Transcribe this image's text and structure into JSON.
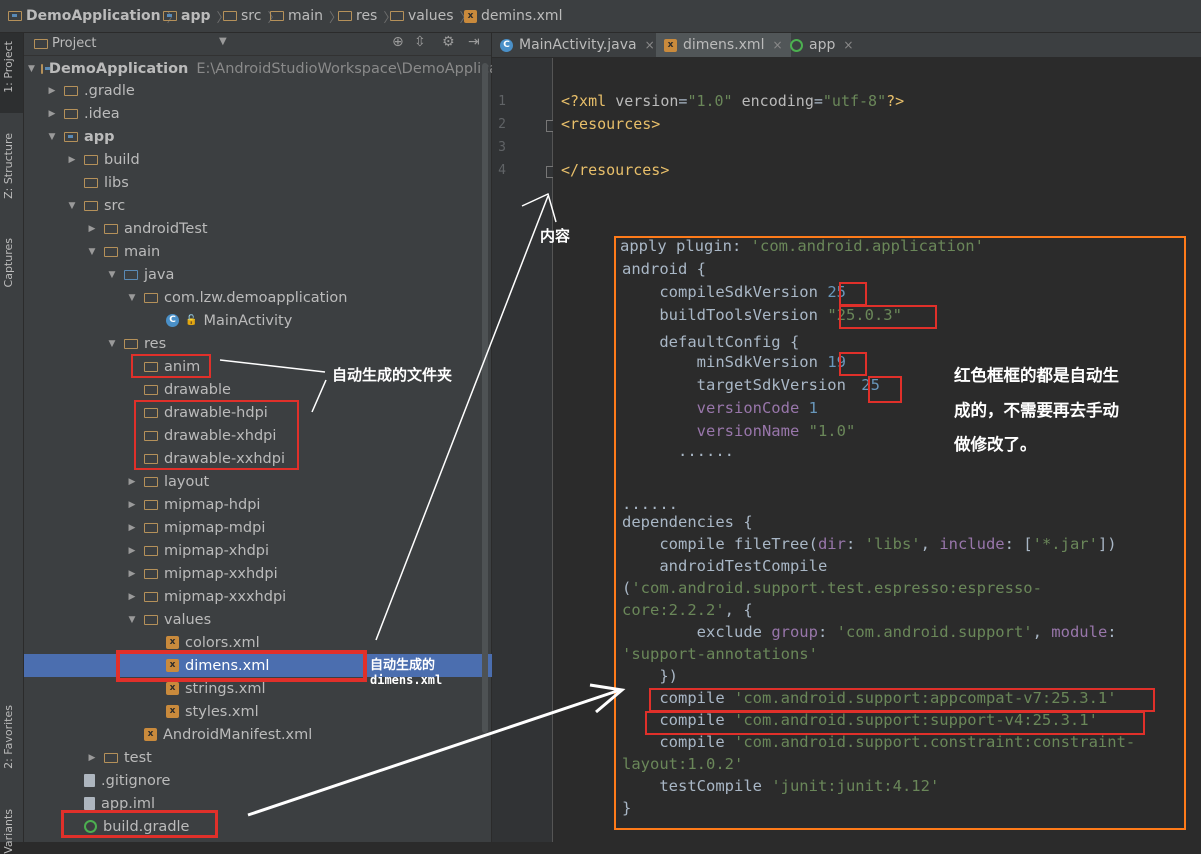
{
  "breadcrumb": [
    {
      "label": "DemoApplication",
      "icon": "folder-icon"
    },
    {
      "label": "app",
      "icon": "module-folder-icon"
    },
    {
      "label": "src",
      "icon": "folder-icon"
    },
    {
      "label": "main",
      "icon": "folder-icon"
    },
    {
      "label": "res",
      "icon": "res-folder-icon"
    },
    {
      "label": "values",
      "icon": "folder-icon"
    },
    {
      "label": "demins.xml",
      "icon": "xml-icon"
    }
  ],
  "side_tabs": {
    "project": "1: Project",
    "structure": "Z: Structure",
    "captures": "Captures",
    "favorites": "2: Favorites",
    "variants": "Variants"
  },
  "project_panel": {
    "header": "Project",
    "root": {
      "label": "DemoApplication",
      "path": "E:\\AndroidStudioWorkspace\\DemoApplicati"
    },
    "items": [
      {
        "label": ".gradle"
      },
      {
        "label": ".idea"
      },
      {
        "label": "app"
      },
      {
        "label": "build"
      },
      {
        "label": "libs"
      },
      {
        "label": "src"
      },
      {
        "label": "androidTest"
      },
      {
        "label": "main"
      },
      {
        "label": "java"
      },
      {
        "label": "com.lzw.demoapplication"
      },
      {
        "label": "MainActivity"
      },
      {
        "label": "res"
      },
      {
        "label": "anim"
      },
      {
        "label": "drawable"
      },
      {
        "label": "drawable-hdpi"
      },
      {
        "label": "drawable-xhdpi"
      },
      {
        "label": "drawable-xxhdpi"
      },
      {
        "label": "layout"
      },
      {
        "label": "mipmap-hdpi"
      },
      {
        "label": "mipmap-mdpi"
      },
      {
        "label": "mipmap-xhdpi"
      },
      {
        "label": "mipmap-xxhdpi"
      },
      {
        "label": "mipmap-xxxhdpi"
      },
      {
        "label": "values"
      },
      {
        "label": "colors.xml"
      },
      {
        "label": "dimens.xml"
      },
      {
        "label": "strings.xml"
      },
      {
        "label": "styles.xml"
      },
      {
        "label": "AndroidManifest.xml"
      },
      {
        "label": "test"
      },
      {
        "label": ".gitignore"
      },
      {
        "label": "app.iml"
      },
      {
        "label": "build.gradle"
      }
    ]
  },
  "editor_tabs": [
    {
      "label": "MainActivity.java"
    },
    {
      "label": "dimens.xml"
    },
    {
      "label": "app"
    }
  ],
  "editor": {
    "line_numbers": [
      "1",
      "2",
      "3",
      "4"
    ],
    "lines": {
      "l1a": "<?xml ",
      "l1b": "version",
      "l1c": "=",
      "l1d": "\"1.0\"",
      "l1e": " encoding",
      "l1f": "=",
      "l1g": "\"utf-8\"",
      "l1h": "?>",
      "l2": "<resources>",
      "l4": "</resources>"
    }
  },
  "overlay_code": {
    "l0a": "apply plugin: ",
    "l0b": "'com.android.application'",
    "l1": "android {",
    "l2a": "    compileSdkVersion ",
    "l2b": "25",
    "l3a": "    buildToolsVersion ",
    "l3b": "\"25.0.3\"",
    "l4": "    defaultConfig {",
    "l5a": "        minSdkVersion ",
    "l5b": "19",
    "l6a": "        targetSdkVersion ",
    "l6b": "25",
    "l7a": "        versionCode ",
    "l7b": "1",
    "l8a": "        versionName ",
    "l8b": "\"1.0\"",
    "l9": "      ......",
    "l10": "......",
    "l11": "dependencies {",
    "l12a": "    compile fileTree(",
    "l12b": "dir",
    ": ": "",
    "l12c": ": ",
    "l12d": "'libs'",
    "l12e": ", ",
    "l12f": "include",
    "l12g": ": [",
    "l12h": "'*.jar'",
    "l12i": "])",
    "l13": "    androidTestCompile",
    "l14a": "(",
    "l14b": "'com.android.support.test.espresso:espresso-",
    "l15a": "core:2.2.2'",
    "l15b": ", {",
    "l16a": "        exclude ",
    "l16b": "group",
    "l16c": ": ",
    "l16d": "'com.android.support'",
    "l16e": ", ",
    "l16f": "module",
    "l16g": ":",
    "l17a": "'support-annotations'",
    "l18": "    })",
    "l19a": "    compile ",
    "l19b": "'com.android.support:appcompat-v7:25.3.1'",
    "l20a": "    compile ",
    "l20b": "'com.android.support:support-v4:25.3.1'",
    "l21a": "    compile ",
    "l21b": "'com.android.support.constraint:constraint-",
    "l22a": "layout:1.0.2'",
    "l23a": "    testCompile ",
    "l23b": "'junit:junit:4.12'",
    "l24": "}"
  },
  "annotations": {
    "content": "内容",
    "auto_folders": "自动生成的文件夹",
    "auto_dimens_1": "自动生成的",
    "auto_dimens_2": "dimens.xml",
    "note_1": "红色框框的都是自动生",
    "note_2": "成的，不需要再去手动",
    "note_3": "做修改了。"
  },
  "colors": {
    "highlight_box": "#e0302a",
    "overlay_border": "#ff7b1a",
    "selection": "#4b6eaf"
  }
}
